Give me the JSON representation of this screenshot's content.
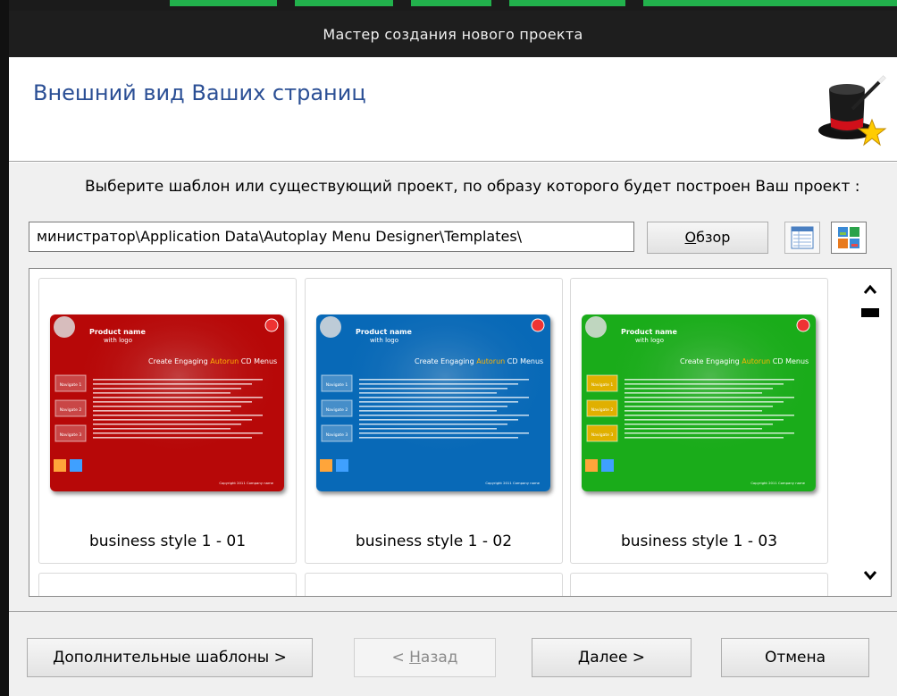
{
  "window": {
    "title": "Мастер создания нового проекта"
  },
  "header": {
    "title": "Внешний вид Ваших страниц",
    "icon": "magic-hat-icon"
  },
  "prompt": "Выберите шаблон или существующий проект, по образу которого будет построен Ваш проект :",
  "path": {
    "value": "министратор\\Application Data\\Autoplay Menu Designer\\Templates\\"
  },
  "browse_button": {
    "label_underlined": "О",
    "label_rest": "бзор"
  },
  "view_buttons": [
    {
      "name": "list-view-icon"
    },
    {
      "name": "thumbnail-view-icon"
    }
  ],
  "templates": [
    {
      "label": "business style 1 - 01",
      "color": "#d10a0a"
    },
    {
      "label": "business style 1 - 02",
      "color": "#0a78d1"
    },
    {
      "label": "business style 1 - 03",
      "color": "#1ec41e"
    }
  ],
  "thumbnail_text": {
    "product_name": "Product name",
    "with_logo": "with logo",
    "headline_part1": "Create Engaging",
    "headline_accent": "Autorun",
    "headline_part2": "CD Menus",
    "nav": [
      "Navigate 1",
      "Navigate 2",
      "Navigate 3"
    ],
    "copyright": "Copyright 2011 Company name"
  },
  "footer": {
    "more_templates": "Дополнительные шаблоны >",
    "back_prefix": "< ",
    "back_underlined": "Н",
    "back_rest": "азад",
    "next_underlined": "Д",
    "next_rest": "алее >",
    "cancel": "Отмена"
  }
}
